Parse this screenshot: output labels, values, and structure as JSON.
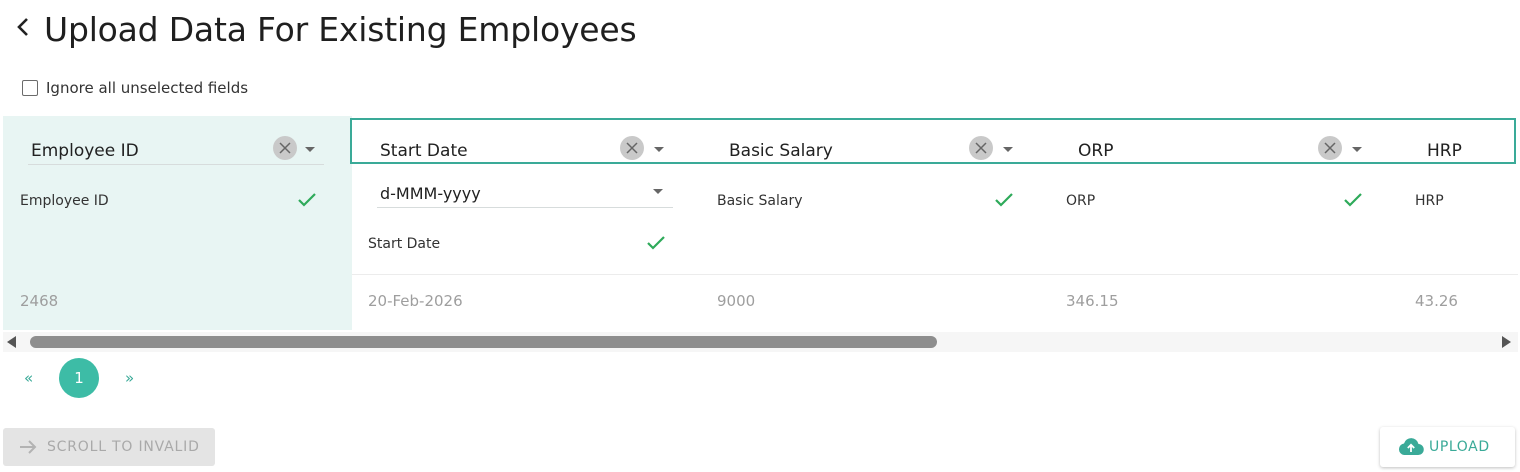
{
  "page": {
    "title": "Upload Data For Existing Employees"
  },
  "options": {
    "ignore_unselected_label": "Ignore all unselected fields",
    "ignore_unselected_checked": false
  },
  "columns": [
    {
      "selected": "Employee ID",
      "field": "Employee ID",
      "value": "2468"
    },
    {
      "selected": "Start Date",
      "format": "d-MMM-yyyy",
      "field": "Start Date",
      "value": "20-Feb-2026"
    },
    {
      "selected": "Basic Salary",
      "field": "Basic Salary",
      "value": "9000"
    },
    {
      "selected": "ORP",
      "field": "ORP",
      "value": "346.15"
    },
    {
      "selected": "HRP",
      "field": "HRP",
      "value": "43.26"
    }
  ],
  "pagination": {
    "prev": "«",
    "current": "1",
    "next": "»"
  },
  "actions": {
    "scroll_to_invalid": "SCROLL TO INVALID",
    "upload": "UPLOAD"
  },
  "colors": {
    "accent": "#3aaa98",
    "check": "#2eaa5a",
    "sticky_bg": "#e8f5f3",
    "pagination_bg": "#3dbca6"
  }
}
